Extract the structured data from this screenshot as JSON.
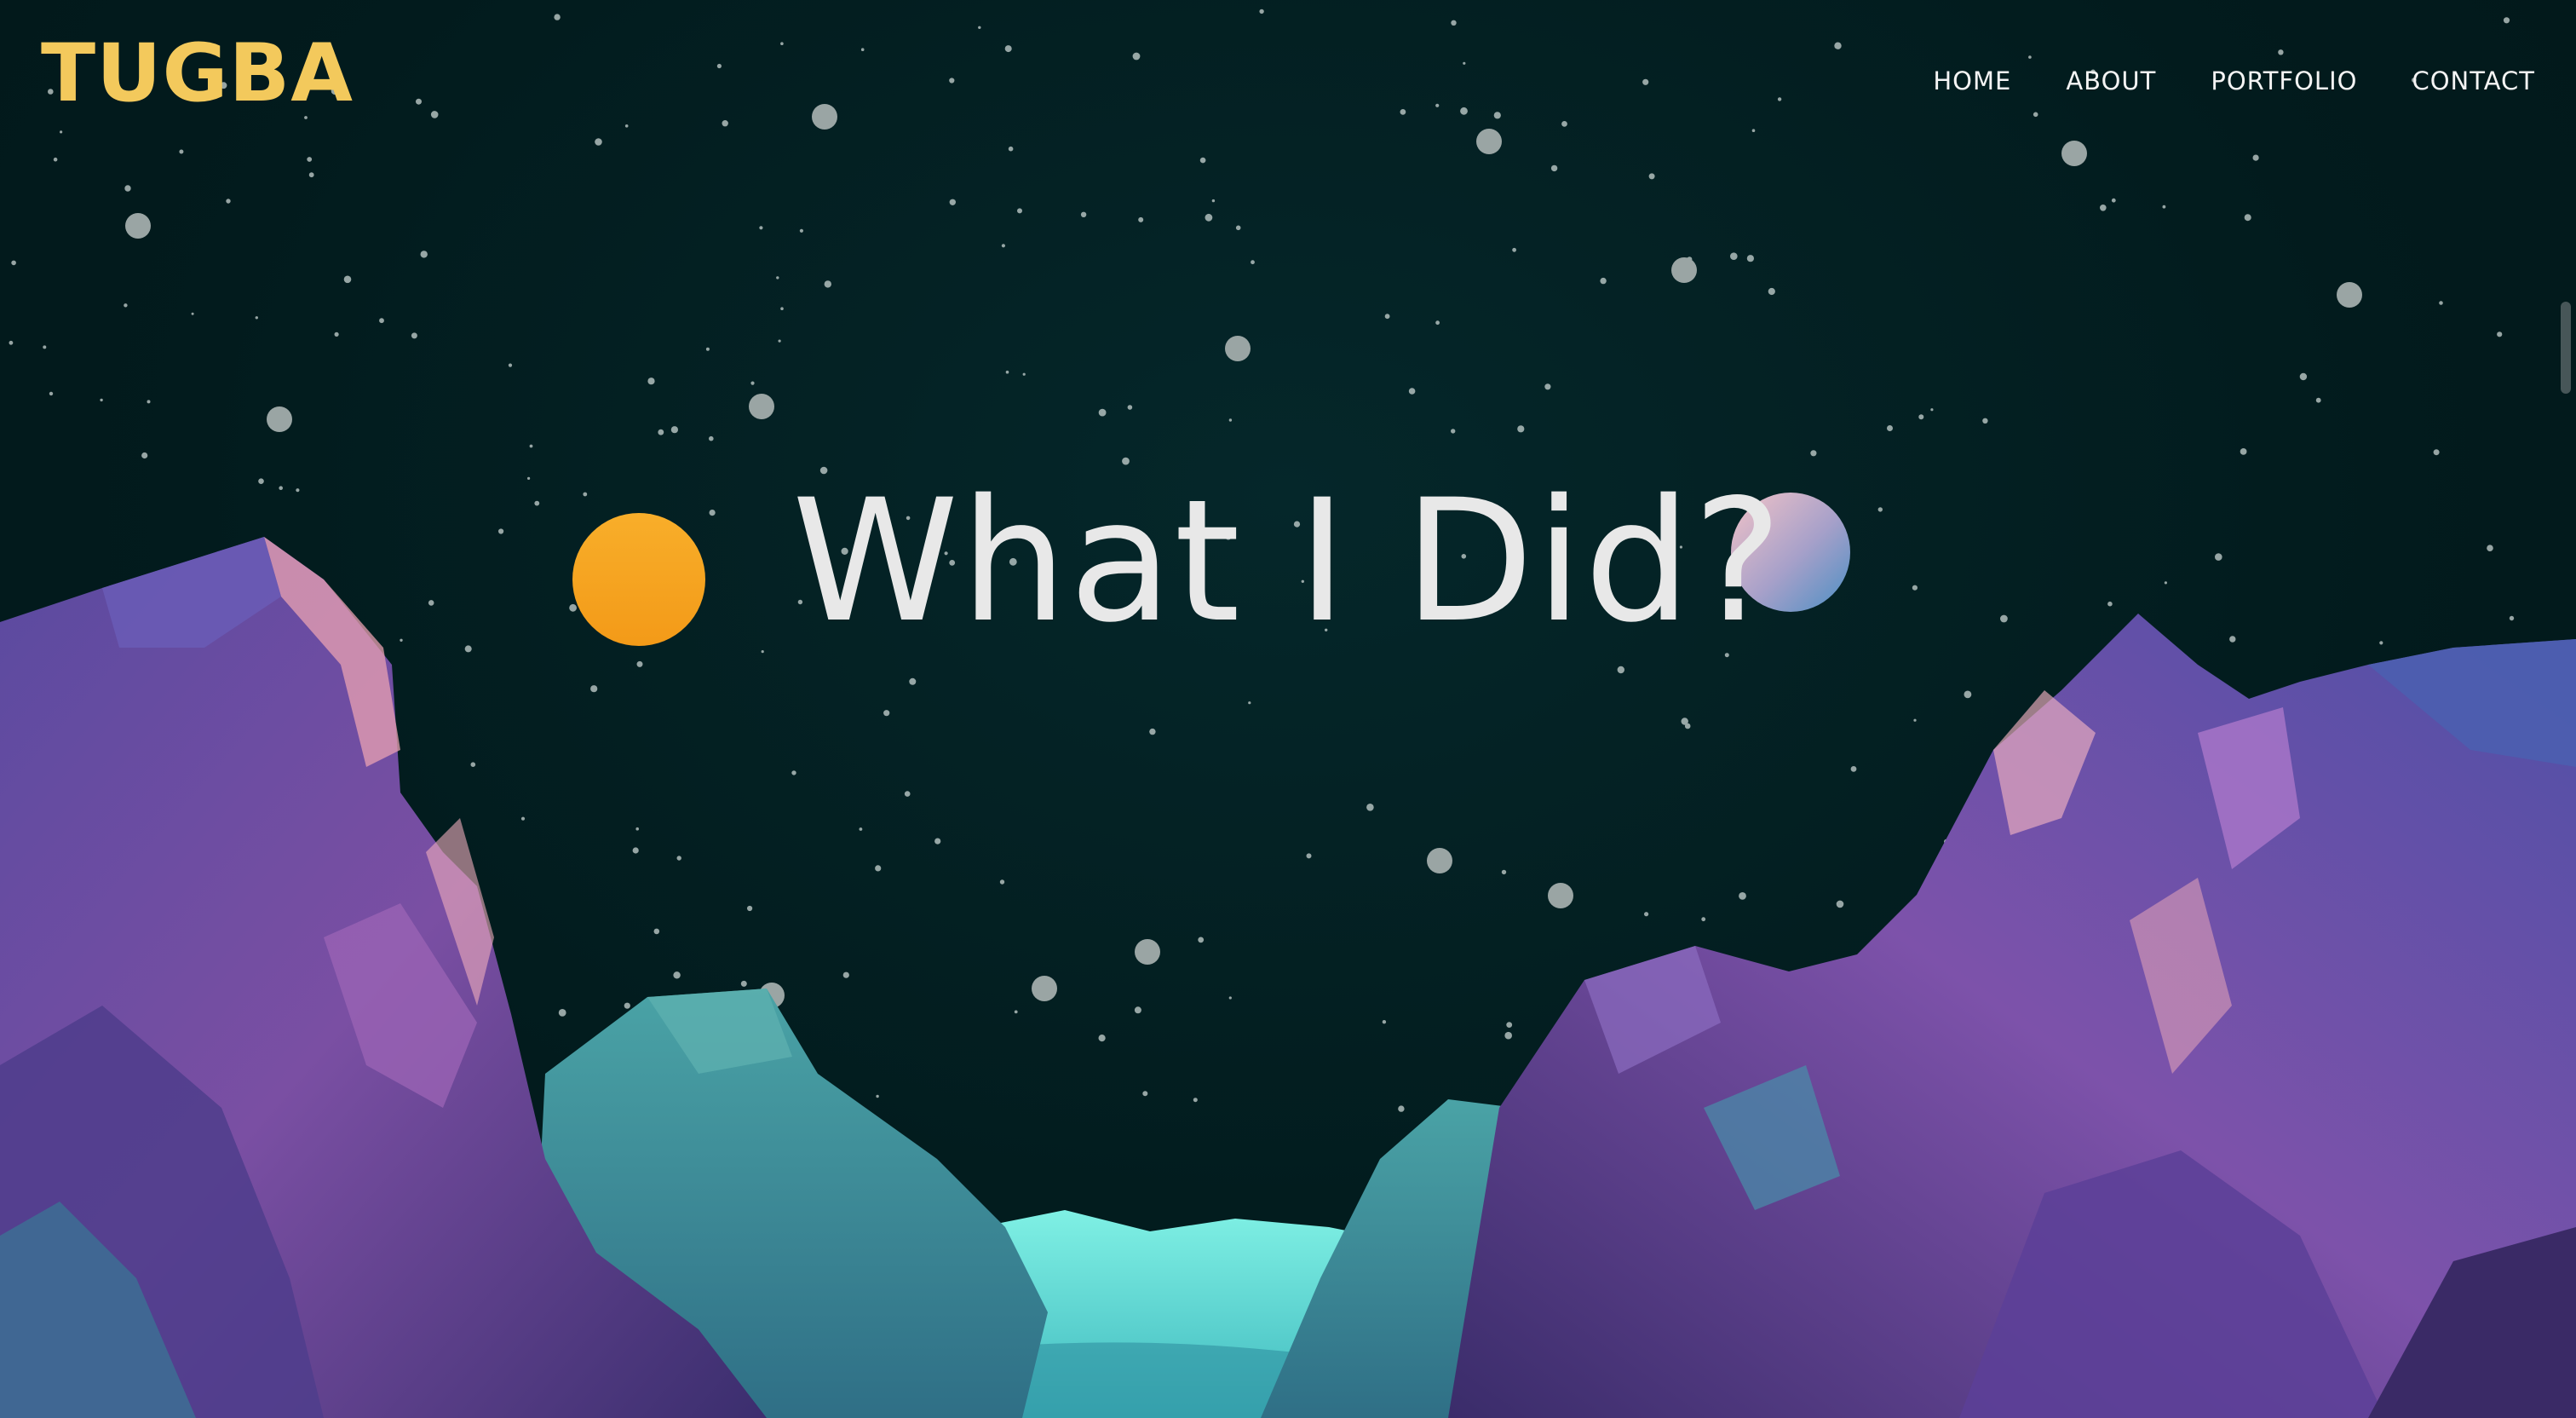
{
  "brand": {
    "logo_text": "TUGBA"
  },
  "nav": {
    "items": [
      {
        "label": "HOME"
      },
      {
        "label": "ABOUT"
      },
      {
        "label": "PORTFOLIO"
      },
      {
        "label": "CONTACT"
      }
    ]
  },
  "hero": {
    "title": "What I Did?"
  },
  "colors": {
    "background": "#021b1d",
    "logo": "#f3c95c",
    "sun": "#f6a41e",
    "nav_text": "#f4f4f4",
    "title_text": "#e8e8e8",
    "water": "#6fe6dc",
    "rock_purple": "#7a4fa3",
    "rock_teal": "#3f8f95"
  }
}
